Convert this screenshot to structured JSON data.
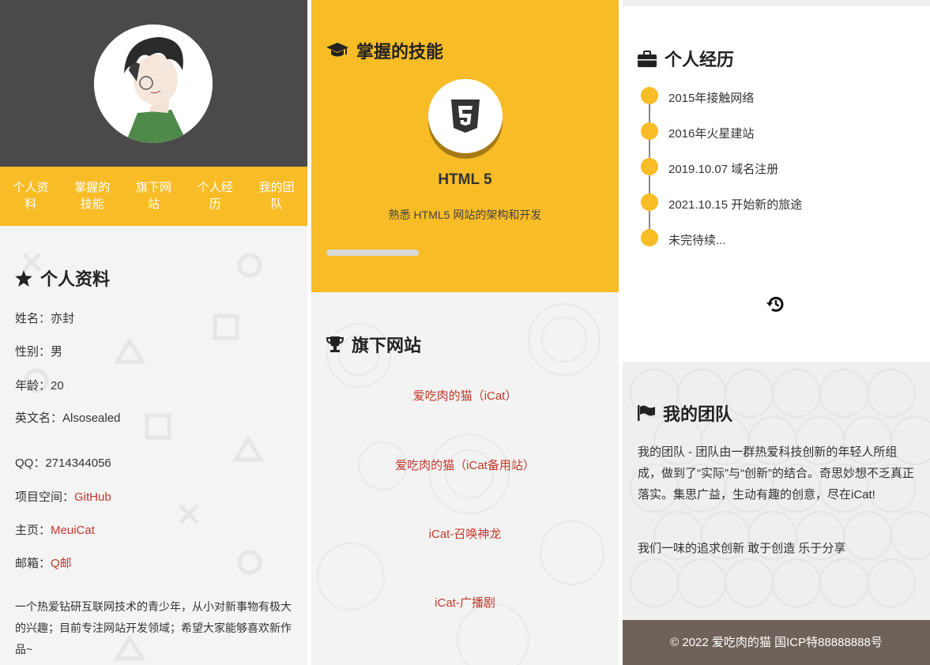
{
  "nav": [
    {
      "label": "个人资料"
    },
    {
      "label": "掌握的技能"
    },
    {
      "label": "旗下网站"
    },
    {
      "label": "个人经历"
    },
    {
      "label": "我的团队"
    }
  ],
  "profile": {
    "heading": "个人资料",
    "name": {
      "label": "姓名：",
      "value": "亦封"
    },
    "gender": {
      "label": "性别：",
      "value": "男"
    },
    "age": {
      "label": "年龄：",
      "value": "20"
    },
    "english_name": {
      "label": "英文名：",
      "value": "Alsosealed"
    },
    "qq": {
      "label": "QQ：",
      "value": "2714344056"
    },
    "project": {
      "label": "项目空间：",
      "value": "GitHub"
    },
    "homepage": {
      "label": "主页：",
      "value": "MeuiCat"
    },
    "email": {
      "label": "邮箱：",
      "value": "Q邮"
    },
    "bio": "一个热爱钻研互联网技术的青少年，从小对新事物有极大的兴趣；目前专注网站开发领域；希望大家能够喜欢新作品~"
  },
  "skills": {
    "heading": "掌握的技能",
    "title": "HTML 5",
    "description": "熟悉 HTML5 网站的架构和开发",
    "icon": "html5-icon",
    "progress_fraction": 0.3
  },
  "sites": {
    "heading": "旗下网站",
    "items": [
      {
        "label": "爱吃肉的猫（iCat）"
      },
      {
        "label": "爱吃肉的猫（iCat备用站）"
      },
      {
        "label": "iCat-召唤神龙"
      },
      {
        "label": "iCat-广播剧"
      }
    ]
  },
  "experience": {
    "heading": "个人经历",
    "items": [
      {
        "label": "2015年接触网络"
      },
      {
        "label": "2016年火星建站"
      },
      {
        "label": "2019.10.07 域名注册"
      },
      {
        "label": "2021.10.15 开始新的旅途"
      },
      {
        "label": "未完待续..."
      }
    ]
  },
  "team": {
    "heading": "我的团队",
    "paragraph1": "我的团队 - 团队由一群热爱科技创新的年轻人所组成，做到了“实际”与“创新”的结合。奇思妙想不乏真正落实。集思广益，生动有趣的创意，尽在iCat!",
    "paragraph2": "我们一味的追求创新 敢于创造 乐于分享"
  },
  "footer": {
    "text": "© 2022 爱吃肉的猫 国ICP特88888888号"
  },
  "colors": {
    "accent": "#f8bc27",
    "dark": "#4a4a4a",
    "link": "#c0392b",
    "footer": "#6f6259"
  }
}
